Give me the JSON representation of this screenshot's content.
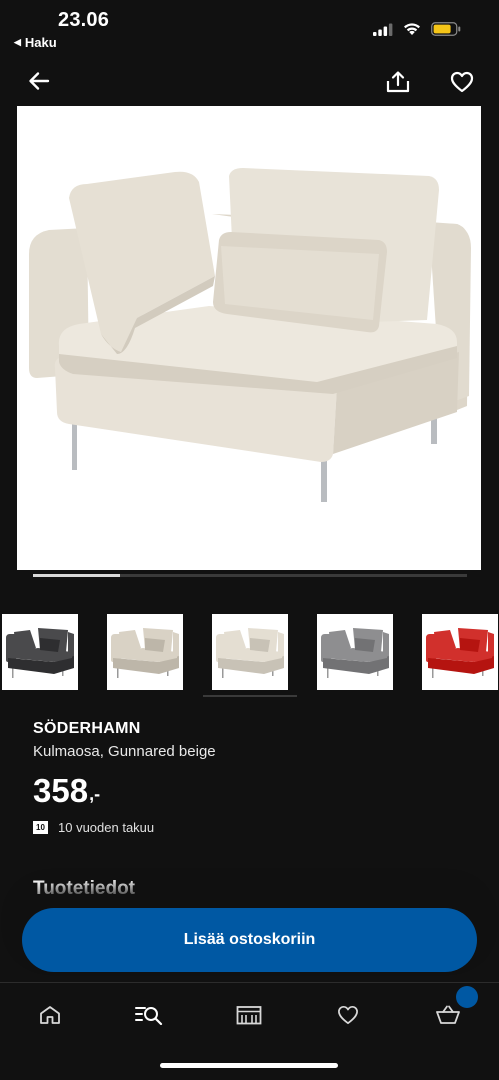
{
  "status_bar": {
    "time": "23.06",
    "back_app": "Haku"
  },
  "product": {
    "brand": "SÖDERHAMN",
    "description": "Kulmaosa, Gunnared beige",
    "price": "358",
    "price_suffix": ",-",
    "warranty_badge": "10",
    "warranty_text": "10 vuoden takuu"
  },
  "gallery": {
    "progress": 0.2,
    "thumbnails": [
      {
        "name": "dark grey",
        "color": "#4a4a4c"
      },
      {
        "name": "beige",
        "color": "#d9d2c5"
      },
      {
        "name": "light beige",
        "color": "#e4ded2"
      },
      {
        "name": "medium grey",
        "color": "#8e8e90"
      },
      {
        "name": "red",
        "color": "#d1302c"
      }
    ]
  },
  "section": {
    "title": "Tuotetiedot"
  },
  "cta": {
    "label": "Lisää ostoskoriin"
  },
  "nav": {
    "items": [
      "home-icon",
      "search-icon",
      "store-icon",
      "heart-icon",
      "cart-icon"
    ]
  },
  "colors": {
    "background": "#111111",
    "accent": "#0058a3",
    "sofa_fabric": "#e6e0d4"
  }
}
